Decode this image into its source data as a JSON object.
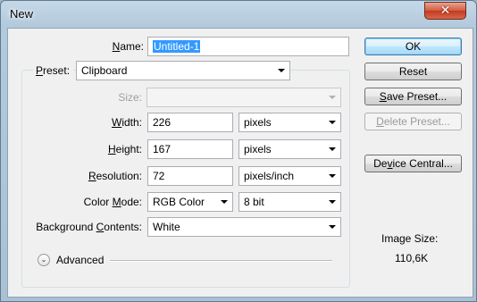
{
  "window": {
    "title": "New",
    "close_glyph": "✕"
  },
  "form": {
    "name_label_pre": "",
    "name_label_key": "N",
    "name_label_post": "ame:",
    "name_value": "Untitled-1",
    "preset_label_pre": "",
    "preset_label_key": "P",
    "preset_label_post": "reset:",
    "preset_value": "Clipboard",
    "size_label": "Size:",
    "size_value": "",
    "width_label_pre": "",
    "width_label_key": "W",
    "width_label_post": "idth:",
    "width_value": "226",
    "width_unit": "pixels",
    "height_label_pre": "",
    "height_label_key": "H",
    "height_label_post": "eight:",
    "height_value": "167",
    "height_unit": "pixels",
    "resolution_label_pre": "",
    "resolution_label_key": "R",
    "resolution_label_post": "esolution:",
    "resolution_value": "72",
    "resolution_unit": "pixels/inch",
    "color_mode_label_pre": "Color ",
    "color_mode_label_key": "M",
    "color_mode_label_post": "ode:",
    "color_mode_value": "RGB Color",
    "bit_depth_value": "8 bit",
    "background_label_pre": "Background ",
    "background_label_key": "C",
    "background_label_post": "ontents:",
    "background_value": "White",
    "advanced_label": "Advanced",
    "advanced_glyph": "⌄"
  },
  "buttons": {
    "ok": "OK",
    "reset": "Reset",
    "save_preset_pre": "",
    "save_preset_key": "S",
    "save_preset_post": "ave Preset...",
    "delete_preset_pre": "",
    "delete_preset_key": "D",
    "delete_preset_post": "elete Preset...",
    "device_central_pre": "De",
    "device_central_key": "v",
    "device_central_post": "ice Central..."
  },
  "image_size": {
    "label": "Image Size:",
    "value": "110,6K"
  }
}
